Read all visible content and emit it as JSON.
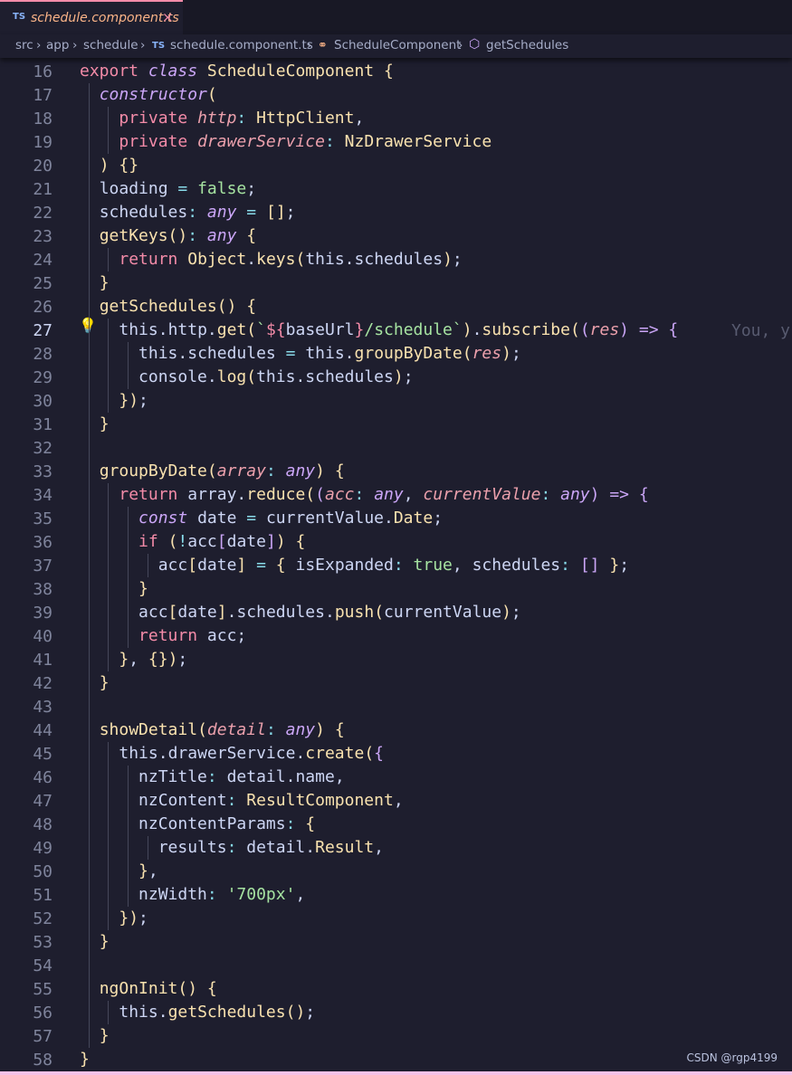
{
  "tab": {
    "badge": "TS",
    "filename": "schedule.component.ts",
    "close": "×"
  },
  "breadcrumb": {
    "items": [
      "src",
      "app",
      "schedule",
      "schedule.component.ts",
      "ScheduleComponent",
      "getSchedules"
    ],
    "ts_badge": "TS",
    "separator": "›"
  },
  "editor": {
    "active_line": 27,
    "blame_text": "You, y",
    "lines": [
      {
        "n": 16,
        "code": "export class ScheduleComponent {"
      },
      {
        "n": 17,
        "code": "  constructor("
      },
      {
        "n": 18,
        "code": "    private http: HttpClient,"
      },
      {
        "n": 19,
        "code": "    private drawerService: NzDrawerService"
      },
      {
        "n": 20,
        "code": "  ) {}"
      },
      {
        "n": 21,
        "code": "  loading = false;"
      },
      {
        "n": 22,
        "code": "  schedules: any = [];"
      },
      {
        "n": 23,
        "code": "  getKeys(): any {"
      },
      {
        "n": 24,
        "code": "    return Object.keys(this.schedules);"
      },
      {
        "n": 25,
        "code": "  }"
      },
      {
        "n": 26,
        "code": "  getSchedules() {"
      },
      {
        "n": 27,
        "code": "    this.http.get(`${baseUrl}/schedule`).subscribe((res) => {"
      },
      {
        "n": 28,
        "code": "      this.schedules = this.groupByDate(res);"
      },
      {
        "n": 29,
        "code": "      console.log(this.schedules);"
      },
      {
        "n": 30,
        "code": "    });"
      },
      {
        "n": 31,
        "code": "  }"
      },
      {
        "n": 32,
        "code": ""
      },
      {
        "n": 33,
        "code": "  groupByDate(array: any) {"
      },
      {
        "n": 34,
        "code": "    return array.reduce((acc: any, currentValue: any) => {"
      },
      {
        "n": 35,
        "code": "      const date = currentValue.Date;"
      },
      {
        "n": 36,
        "code": "      if (!acc[date]) {"
      },
      {
        "n": 37,
        "code": "        acc[date] = { isExpanded: true, schedules: [] };"
      },
      {
        "n": 38,
        "code": "      }"
      },
      {
        "n": 39,
        "code": "      acc[date].schedules.push(currentValue);"
      },
      {
        "n": 40,
        "code": "      return acc;"
      },
      {
        "n": 41,
        "code": "    }, {});"
      },
      {
        "n": 42,
        "code": "  }"
      },
      {
        "n": 43,
        "code": ""
      },
      {
        "n": 44,
        "code": "  showDetail(detail: any) {"
      },
      {
        "n": 45,
        "code": "    this.drawerService.create({"
      },
      {
        "n": 46,
        "code": "      nzTitle: detail.name,"
      },
      {
        "n": 47,
        "code": "      nzContent: ResultComponent,"
      },
      {
        "n": 48,
        "code": "      nzContentParams: {"
      },
      {
        "n": 49,
        "code": "        results: detail.Result,"
      },
      {
        "n": 50,
        "code": "      },"
      },
      {
        "n": 51,
        "code": "      nzWidth: '700px',"
      },
      {
        "n": 52,
        "code": "    });"
      },
      {
        "n": 53,
        "code": "  }"
      },
      {
        "n": 54,
        "code": ""
      },
      {
        "n": 55,
        "code": "  ngOnInit() {"
      },
      {
        "n": 56,
        "code": "    this.getSchedules();"
      },
      {
        "n": 57,
        "code": "  }"
      },
      {
        "n": 58,
        "code": "}"
      }
    ]
  },
  "watermark": "CSDN @rgp4199",
  "colors": {
    "background": "#1e1e2e",
    "tab_accent": "#f38ba8",
    "bottom_bar": "#f5c2e7"
  }
}
